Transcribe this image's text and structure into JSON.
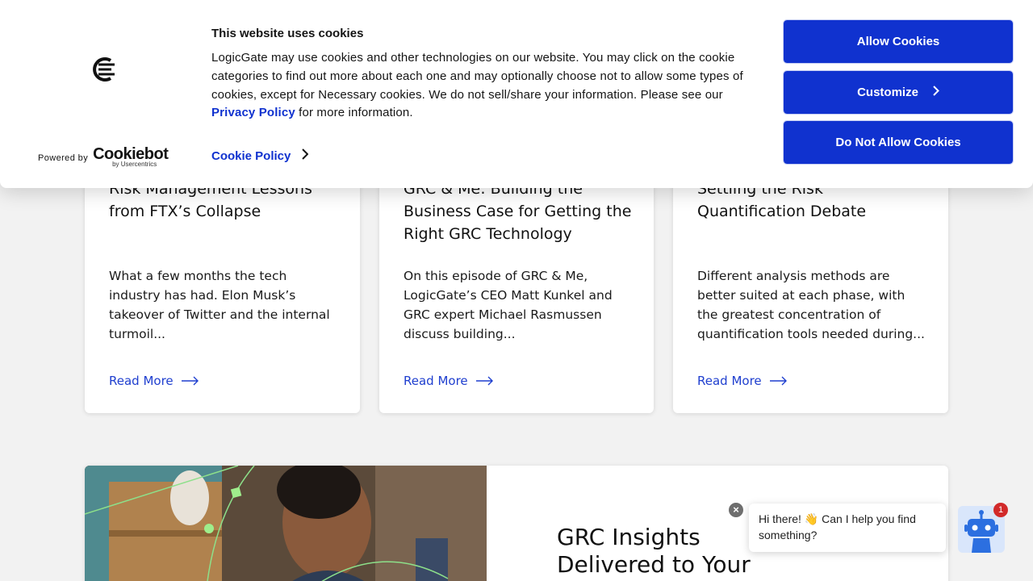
{
  "cards": [
    {
      "title": "Risk Management Lessons from FTX’s Collapse",
      "description": "What a few months the tech industry has had.  Elon Musk’s takeover of Twitter and the internal turmoil...",
      "read_more": "Read More"
    },
    {
      "title": "GRC & Me: Building the Business Case for Getting the Right GRC Technology",
      "description": "On this episode of GRC & Me, LogicGate’s CEO Matt Kunkel and GRC expert Michael Rasmussen discuss building...",
      "read_more": "Read More"
    },
    {
      "title": "Settling the Risk Quantification Debate",
      "description": "Different analysis methods are better suited at each phase, with the greatest concentration of quantification tools needed during...",
      "read_more": "Read More"
    }
  ],
  "newsletter": {
    "title": "GRC Insights Delivered to Your Inbox"
  },
  "cookie_banner": {
    "heading": "This website uses cookies",
    "text_before_link": "LogicGate may use cookies and other technologies on our website. You may click on the cookie categories to find out more about each one and may optionally choose not to allow some types of cookies, except for Necessary cookies.  We do not sell/share your information. Please see our ",
    "privacy_link": "Privacy Policy",
    "text_after_link": " for more information.",
    "cookie_policy_link": "Cookie Policy",
    "powered_by": "Powered by",
    "cookiebot_word": "Cookiebot",
    "cookiebot_sub": "by Usercentrics",
    "allow_button": "Allow Cookies",
    "customize_button": "Customize",
    "deny_button": "Do Not Allow Cookies"
  },
  "chat": {
    "message": "Hi there! 👋 Can I help you find something?",
    "badge_count": "1",
    "close_symbol": "×"
  },
  "colors": {
    "accent_blue": "#1032cf",
    "link_blue": "#1f3fcf",
    "badge_red": "#d22a2a"
  }
}
